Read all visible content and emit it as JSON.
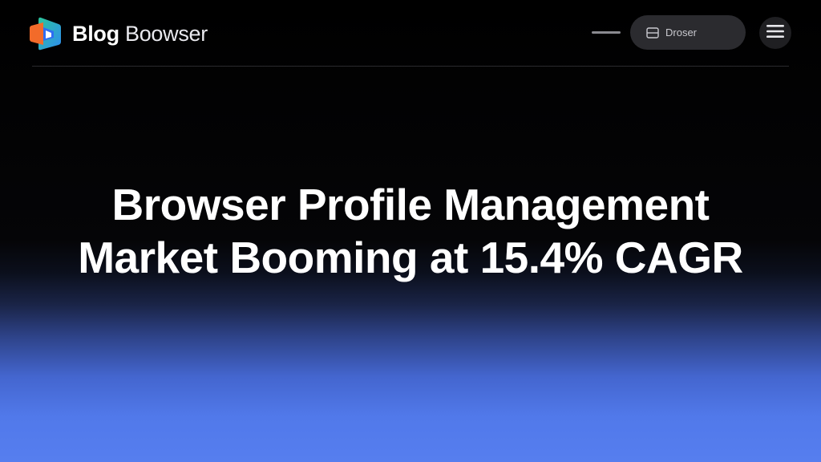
{
  "header": {
    "brand_primary": "Blog",
    "brand_secondary": "Boowser",
    "logo_icon": "browser-logo-icon",
    "pill_button": {
      "label": "Droser",
      "icon": "window-icon"
    },
    "menu_icon": "hamburger-menu-icon"
  },
  "hero": {
    "title_line1": "Browser Profile Management",
    "title_line2": "Market Booming at 15.4% CAGR"
  },
  "colors": {
    "background_top": "#000000",
    "gradient_bottom": "#567eef",
    "logo_orange": "#f26b2a",
    "logo_blue": "#2f6df2",
    "logo_green": "#2bc49a",
    "text": "#ffffff"
  }
}
